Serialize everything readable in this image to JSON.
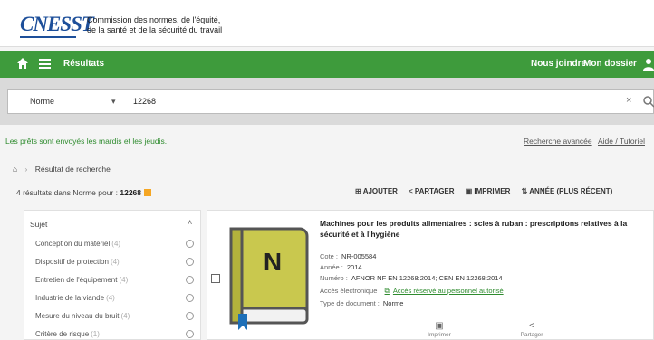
{
  "header": {
    "logo": "CNESST",
    "org_line1": "Commission des normes, de l'équité,",
    "org_line2": "de la santé et de la sécurité du travail"
  },
  "nav": {
    "title": "Résultats",
    "contact": "Nous joindre",
    "file": "Mon dossier"
  },
  "search": {
    "scope": "Norme",
    "query": "12268"
  },
  "notice": "Les prêts sont envoyés les mardis et les jeudis.",
  "links": {
    "advanced": "Recherche avancée",
    "help": "Aide / Tutoriel"
  },
  "breadcrumb": {
    "current": "Résultat de recherche"
  },
  "results": {
    "prefix": "4 résultats dans Norme pour :",
    "query": "12268"
  },
  "toolbar": {
    "add": "AJOUTER",
    "share": "PARTAGER",
    "print": "IMPRIMER",
    "sort": "ANNÉE (PLUS RÉCENT)"
  },
  "facets": {
    "heading": "Sujet",
    "items": [
      {
        "label": "Conception du matériel",
        "count": "(4)"
      },
      {
        "label": "Dispositif de protection",
        "count": "(4)"
      },
      {
        "label": "Entretien de l'équipement",
        "count": "(4)"
      },
      {
        "label": "Industrie de la viande",
        "count": "(4)"
      },
      {
        "label": "Mesure du niveau du bruit",
        "count": "(4)"
      },
      {
        "label": "Critère de risque",
        "count": "(1)"
      }
    ]
  },
  "result": {
    "book_letter": "N",
    "title": "Machines pour les produits alimentaires : scies à ruban : prescriptions relatives à la sécurité et à l'hygiène",
    "cote_label": "Cote :",
    "cote": "NR-005584",
    "year_label": "Année :",
    "year": "2014",
    "number_label": "Numéro :",
    "number": "AFNOR NF EN 12268:2014; CEN EN 12268:2014",
    "access_label": "Accès électronique :",
    "access": "Accès réservé au personnel autorisé",
    "doctype_label": "Type de document :",
    "doctype": "Norme",
    "print_label": "Imprimer",
    "share_label": "Partager"
  },
  "colors": {
    "brand_blue": "#1d4f9a",
    "nav_green": "#3e9b3c",
    "link_green": "#2e8b2e",
    "book_olive": "#c9c84e",
    "rss_orange": "#f5a623"
  }
}
